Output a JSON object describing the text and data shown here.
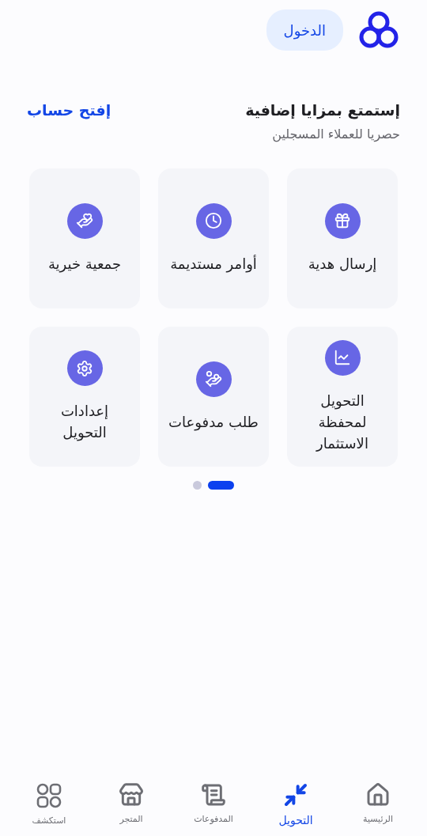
{
  "header": {
    "login_button": "الدخول"
  },
  "promo": {
    "title": "إستمتع بمزايا إضافية",
    "subtitle": "حصريا للعملاء المسجلين",
    "link": "إفتح حساب"
  },
  "services": [
    {
      "label": "إرسال هدية"
    },
    {
      "label": "أوامر مستديمة"
    },
    {
      "label": "جمعية خيرية"
    },
    {
      "label": "التحويل لمحفظة الاستثمار"
    },
    {
      "label": "طلب مدفوعات"
    },
    {
      "label": "إعدادات التحويل"
    }
  ],
  "pager": [
    {
      "selected": true
    },
    {
      "selected": false
    }
  ],
  "bottom_nav": [
    {
      "label": "الرئيسية",
      "selected": false
    },
    {
      "label": "التحويل",
      "selected": true
    },
    {
      "label": "المدفوعات",
      "selected": false
    },
    {
      "label": "المتجر",
      "selected": false
    },
    {
      "label": "استكشف",
      "selected": false
    }
  ]
}
